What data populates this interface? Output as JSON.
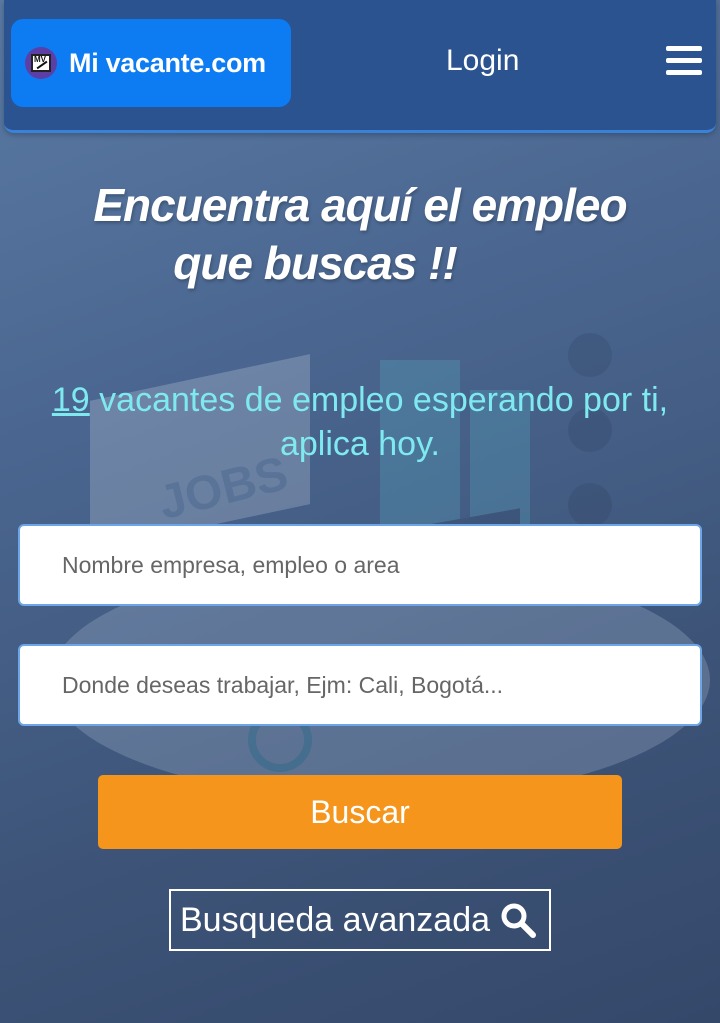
{
  "navbar": {
    "brand": "Mi vacante.com",
    "brand_logo_letters": "MV",
    "login_label": "Login",
    "menu_icon": "hamburger-icon"
  },
  "hero": {
    "headline_line1": "Encuentra aquí el empleo",
    "headline_line2": "que buscas !!",
    "vacancies_count": "19",
    "vacancies_text": "vacantes de empleo esperando por ti, aplica hoy."
  },
  "search": {
    "keyword_placeholder": "Nombre empresa, empleo o area",
    "location_placeholder": "Donde deseas trabajar, Ejm: Cali, Bogotá...",
    "submit_label": "Buscar",
    "advanced_label": "Busqueda avanzada",
    "advanced_icon": "search-icon"
  },
  "colors": {
    "navbar": "#2a5390",
    "brand_bg": "#0d7bf2",
    "subline": "#7fe9f0",
    "button": "#f5951c"
  }
}
